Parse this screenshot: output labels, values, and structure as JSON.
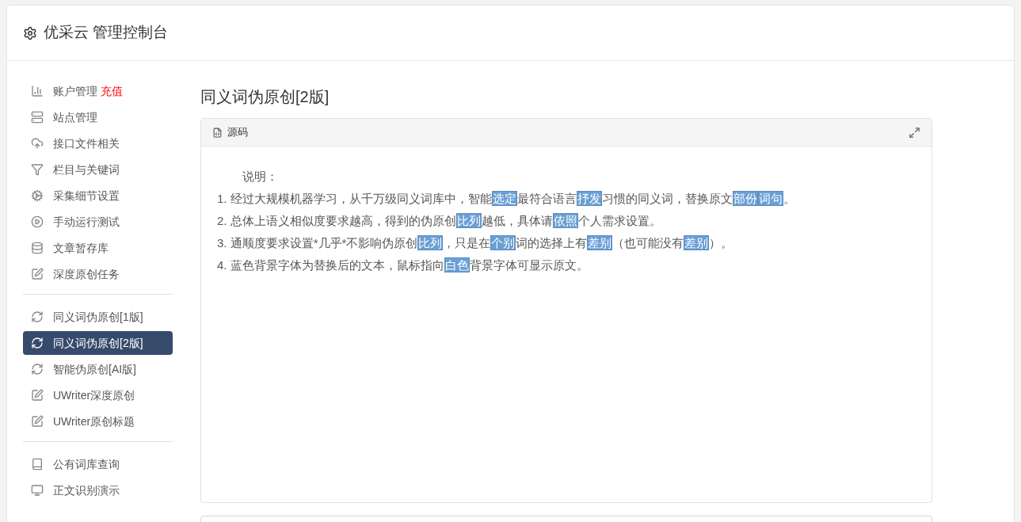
{
  "header": {
    "title": "优采云 管理控制台"
  },
  "sidebar": {
    "groups": [
      {
        "items": [
          {
            "label": "账户管理",
            "badge": "充值",
            "selected": false
          },
          {
            "label": "站点管理",
            "selected": false
          },
          {
            "label": "接口文件相关",
            "selected": false
          },
          {
            "label": "栏目与关键词",
            "selected": false
          },
          {
            "label": "采集细节设置",
            "selected": false
          },
          {
            "label": "手动运行测试",
            "selected": false
          },
          {
            "label": "文章暂存库",
            "selected": false
          },
          {
            "label": "深度原创任务",
            "selected": false
          }
        ]
      },
      {
        "items": [
          {
            "label": "同义词伪原创[1版]",
            "selected": false
          },
          {
            "label": "同义词伪原创[2版]",
            "selected": true
          },
          {
            "label": "智能伪原创[AI版]",
            "selected": false
          },
          {
            "label": "UWriter深度原创",
            "selected": false
          },
          {
            "label": "UWriter原创标题",
            "selected": false
          }
        ]
      },
      {
        "items": [
          {
            "label": "公有词库查询",
            "selected": false
          },
          {
            "label": "正文识别演示",
            "selected": false
          }
        ]
      }
    ]
  },
  "main": {
    "title": "同义词伪原创[2版]",
    "panel": {
      "title": "源码",
      "heading": "说明：",
      "lines": [
        [
          {
            "text": "1. 经过大规模机器学习，从千万级同义词库中，智能",
            "highlighted": false
          },
          {
            "text": "选定",
            "highlighted": true
          },
          {
            "text": "最符合语言",
            "highlighted": false
          },
          {
            "text": "抒发",
            "highlighted": true
          },
          {
            "text": "习惯的同义词，替换原文",
            "highlighted": false
          },
          {
            "text": "部份",
            "highlighted": true
          },
          {
            "text": "词句",
            "highlighted": true
          },
          {
            "text": "。",
            "highlighted": false
          }
        ],
        [
          {
            "text": "2. 总体上语义相似度要求越高，得到的伪原创",
            "highlighted": false
          },
          {
            "text": "比列",
            "highlighted": true
          },
          {
            "text": "越低，具体请",
            "highlighted": false
          },
          {
            "text": "依照",
            "highlighted": true
          },
          {
            "text": "个人需求设置。",
            "highlighted": false
          }
        ],
        [
          {
            "text": "3. 通顺度要求设置*几乎*不影响伪原创",
            "highlighted": false
          },
          {
            "text": "比列",
            "highlighted": true
          },
          {
            "text": "，只是在",
            "highlighted": false
          },
          {
            "text": "个别",
            "highlighted": true
          },
          {
            "text": "词的选择上有",
            "highlighted": false
          },
          {
            "text": "差别",
            "highlighted": true
          },
          {
            "text": "（也可能没有",
            "highlighted": false
          },
          {
            "text": "差别",
            "highlighted": true
          },
          {
            "text": "）。",
            "highlighted": false
          }
        ],
        [
          {
            "text": "4. 蓝色背景字体为替换后的文本，鼠标指向",
            "highlighted": false
          },
          {
            "text": "白色",
            "highlighted": true
          },
          {
            "text": "背景字体可显示原文。",
            "highlighted": false
          }
        ]
      ]
    }
  }
}
